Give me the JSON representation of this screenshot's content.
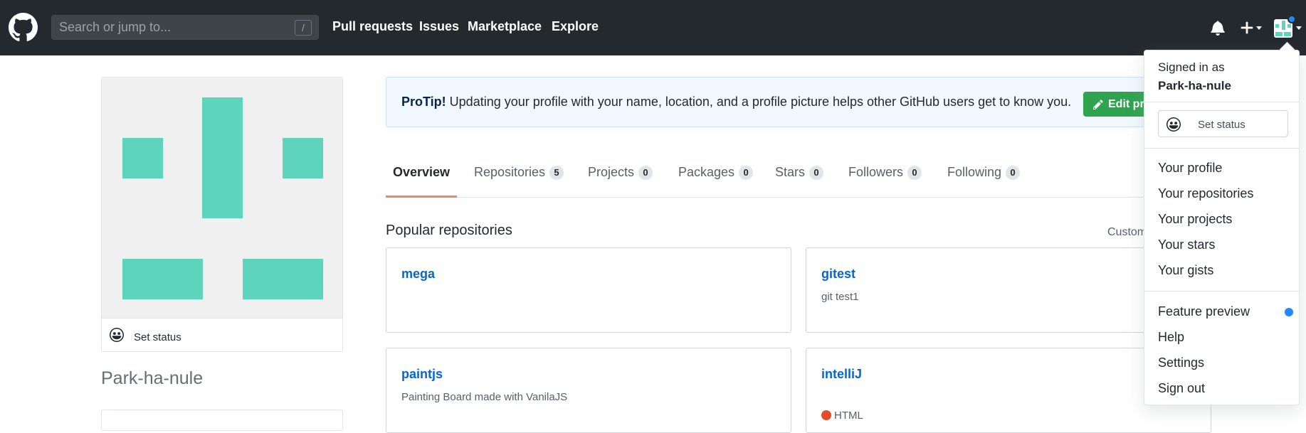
{
  "header": {
    "search_placeholder": "Search or jump to...",
    "search_shortcut": "/",
    "nav": [
      "Pull requests",
      "Issues",
      "Marketplace",
      "Explore"
    ]
  },
  "sidebar": {
    "set_status": "Set status",
    "username": "Park-ha-nule"
  },
  "protip": {
    "label": "ProTip!",
    "text": " Updating your profile with your name, location, and a profile picture helps other GitHub users get to know you.",
    "edit_button": "Edit profile"
  },
  "tabs": [
    {
      "label": "Overview",
      "count": ""
    },
    {
      "label": "Repositories",
      "count": "5"
    },
    {
      "label": "Projects",
      "count": "0"
    },
    {
      "label": "Packages",
      "count": "0"
    },
    {
      "label": "Stars",
      "count": "0"
    },
    {
      "label": "Followers",
      "count": "0"
    },
    {
      "label": "Following",
      "count": "0"
    }
  ],
  "popular": {
    "title": "Popular repositories",
    "customize": "Customize your pins",
    "repos": [
      {
        "name": "mega",
        "desc": "",
        "lang": ""
      },
      {
        "name": "gitest",
        "desc": "git test1",
        "lang": ""
      },
      {
        "name": "paintjs",
        "desc": "Painting Board made with VanilaJS",
        "lang": ""
      },
      {
        "name": "intelliJ",
        "desc": "",
        "lang": "HTML"
      }
    ]
  },
  "dropdown": {
    "signed_in_as": "Signed in as",
    "username": "Park-ha-nule",
    "set_status": "Set status",
    "group1": [
      "Your profile",
      "Your repositories",
      "Your projects",
      "Your stars",
      "Your gists"
    ],
    "group2": [
      "Feature preview",
      "Help",
      "Settings",
      "Sign out"
    ]
  },
  "colors": {
    "header_bg": "#24292e",
    "identicon": "#5dd4bb",
    "link": "#0366d6",
    "active_tab": "#f9826c",
    "button_green": "#2ea44f",
    "html_lang": "#e34c26"
  }
}
